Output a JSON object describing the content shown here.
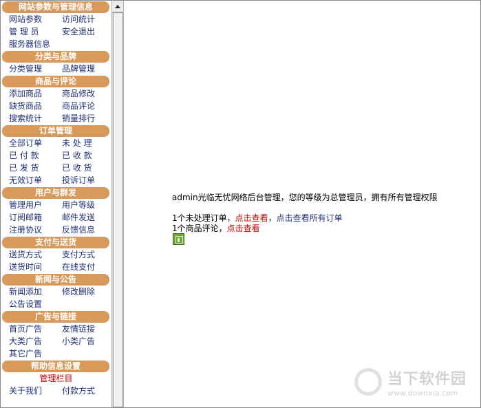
{
  "sidebar": {
    "sections": [
      {
        "title": "网站参数与管理信息",
        "items": [
          "网站参数",
          "访问统计",
          "管 理 员",
          "安全退出",
          "服务器信息"
        ]
      },
      {
        "title": "分类与品牌",
        "items": [
          "分类管理",
          "品牌管理"
        ]
      },
      {
        "title": "商品与评论",
        "items": [
          "添加商品",
          "商品修改",
          "缺货商品",
          "商品评论",
          "搜索统计",
          "销量排行"
        ]
      },
      {
        "title": "订单管理",
        "items": [
          "全部订单",
          "未 处 理",
          "已 付 款",
          "已 收 款",
          "已 发 货",
          "已 收 货",
          "无效订单",
          "投诉订单"
        ]
      },
      {
        "title": "用户与群发",
        "items": [
          "管理用户",
          "用户等级",
          "订阅邮箱",
          "邮件发送",
          "注册协议",
          "反馈信息"
        ]
      },
      {
        "title": "支付与送货",
        "items": [
          "送货方式",
          "支付方式",
          "送货时间",
          "在线支付"
        ]
      },
      {
        "title": "新闻与公告",
        "items": [
          "新闻添加",
          "修改删除",
          "公告设置"
        ]
      },
      {
        "title": "广告与链接",
        "items": [
          "首页广告",
          "友情链接",
          "大类广告",
          "小类广告",
          "其它广告"
        ]
      },
      {
        "title": "帮助信息设置",
        "special": "管理栏目",
        "items": [
          "关于我们",
          "付款方式"
        ]
      }
    ]
  },
  "main": {
    "welcome": "admin光临无忧网络后台管理，您的等级为总管理员，拥有所有管理权限",
    "orders_text": "1个未处理订单，",
    "orders_link": "点击查看",
    "sep": "，",
    "all_orders_link": "点击查看所有订单",
    "reviews_text": "1个商品评论，",
    "reviews_link": "点击查看"
  },
  "watermark": {
    "cn": "当下软件园",
    "url": "www.downxia.com"
  }
}
